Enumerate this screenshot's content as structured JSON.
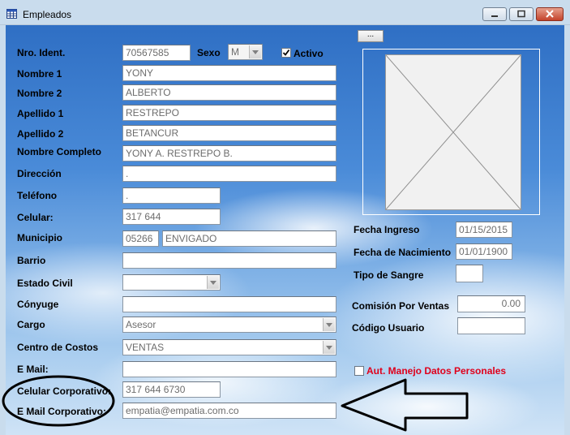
{
  "window": {
    "title": "Empleados",
    "minimize_icon": "minimize-icon",
    "maximize_icon": "maximize-icon",
    "close_icon": "close-icon"
  },
  "form": {
    "nro_ident": {
      "label": "Nro. Ident.",
      "value": "70567585"
    },
    "sexo": {
      "label": "Sexo",
      "value": "M"
    },
    "activo": {
      "label": "Activo",
      "checked": true
    },
    "nombre1": {
      "label": "Nombre 1",
      "value": "YONY"
    },
    "nombre2": {
      "label": "Nombre 2",
      "value": "ALBERTO"
    },
    "apellido1": {
      "label": "Apellido 1",
      "value": "RESTREPO"
    },
    "apellido2": {
      "label": "Apellido 2",
      "value": "BETANCUR"
    },
    "nombre_completo": {
      "label": "Nombre Completo",
      "value": "YONY A. RESTREPO B."
    },
    "direccion": {
      "label": "Dirección",
      "value": "."
    },
    "telefono": {
      "label": "Teléfono",
      "value": "."
    },
    "celular": {
      "label": "Celular:",
      "value": "317 644"
    },
    "municipio": {
      "label": "Municipio",
      "code": "05266",
      "name": "ENVIGADO"
    },
    "barrio": {
      "label": "Barrio",
      "value": ""
    },
    "estado_civil": {
      "label": "Estado Civil",
      "value": ""
    },
    "conyuge": {
      "label": "Cónyuge",
      "value": ""
    },
    "cargo": {
      "label": "Cargo",
      "value": "Asesor"
    },
    "centro_costos": {
      "label": "Centro de Costos",
      "value": "VENTAS"
    },
    "email": {
      "label": "E Mail:",
      "value": ""
    },
    "celular_corporativo": {
      "label": "Celular Corporativo:",
      "value": "317 644 6730"
    },
    "email_corporativo": {
      "label": "E Mail Corporativo:",
      "value": "empatia@empatia.com.co"
    },
    "photo_browse": {
      "label": "..."
    },
    "fecha_ingreso": {
      "label": "Fecha Ingreso",
      "value": "01/15/2015"
    },
    "fecha_nacimiento": {
      "label": "Fecha de Nacimiento",
      "value": "01/01/1900"
    },
    "tipo_sangre": {
      "label": "Tipo de Sangre",
      "value": ""
    },
    "comision_ventas": {
      "label": "Comisión Por Ventas",
      "value": "0.00"
    },
    "codigo_usuario": {
      "label": "Código Usuario",
      "value": ""
    },
    "aut_manejo": {
      "label": "Aut. Manejo Datos Personales",
      "checked": false,
      "color": "#e0001b"
    }
  },
  "annotation": {
    "color": "#000000"
  }
}
